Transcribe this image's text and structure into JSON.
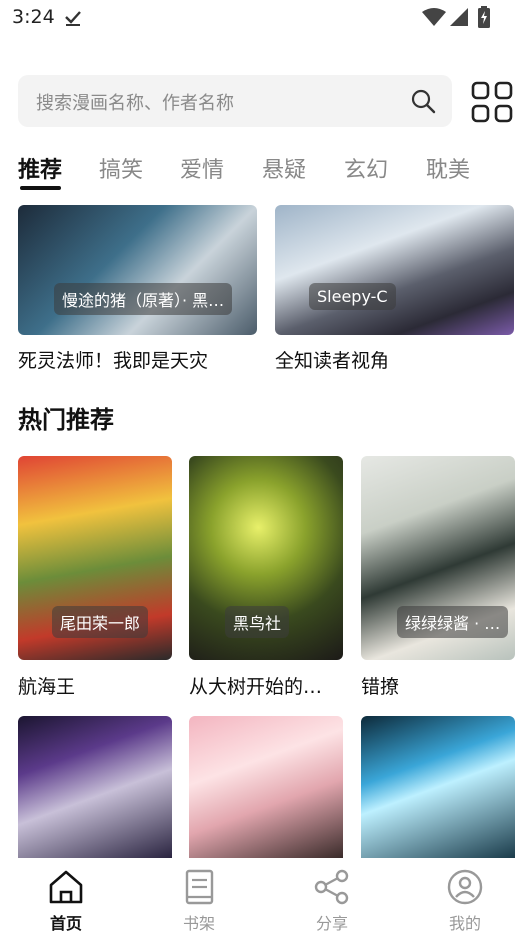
{
  "status": {
    "time": "3:24"
  },
  "search": {
    "placeholder": "搜索漫画名称、作者名称"
  },
  "tabs": [
    "推荐",
    "搞笑",
    "爱情",
    "悬疑",
    "玄幻",
    "耽美"
  ],
  "featured": [
    {
      "author": "慢途的猪（原著）· 黑…",
      "title": "死灵法师！我即是天灾"
    },
    {
      "author": "Sleepy-C",
      "title": "全知读者视角"
    }
  ],
  "hot_section_title": "热门推荐",
  "hot": [
    {
      "author": "尾田荣一郎",
      "title": "航海王"
    },
    {
      "author": "黑鸟社",
      "title": "从大树开始的…"
    },
    {
      "author": "绿绿绿酱 · …",
      "title": "错撩"
    }
  ],
  "bottom_nav": [
    {
      "label": "首页",
      "icon": "home-icon"
    },
    {
      "label": "书架",
      "icon": "bookshelf-icon"
    },
    {
      "label": "分享",
      "icon": "share-icon"
    },
    {
      "label": "我的",
      "icon": "profile-icon"
    }
  ]
}
